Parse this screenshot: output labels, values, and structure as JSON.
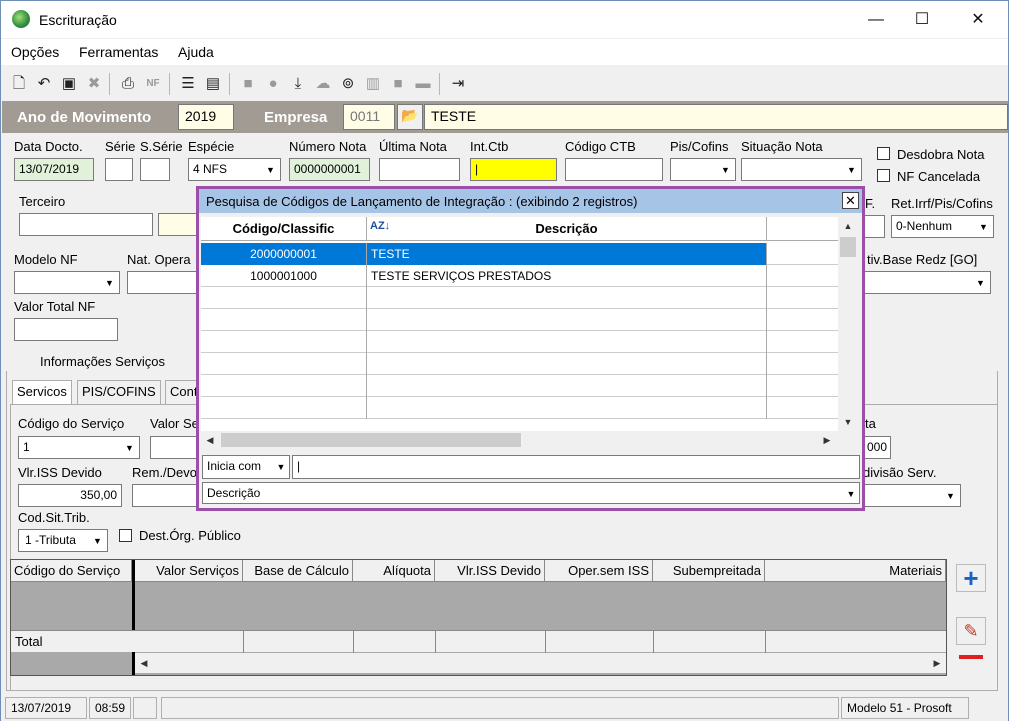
{
  "window": {
    "title": "Escrituração",
    "minimize": "—",
    "maximize": "☐",
    "close": "✕"
  },
  "menu": {
    "items": [
      "Opções",
      "Ferramentas",
      "Ajuda"
    ]
  },
  "toolbar": {
    "icons": [
      "new-icon",
      "undo-icon",
      "save-icon",
      "delete-icon",
      "preview-icon",
      "nfe-icon",
      "tree-icon",
      "calc-icon",
      "folder-icon",
      "apple-icon",
      "import-icon",
      "cloud-icon",
      "cib-icon",
      "barcode-icon",
      "gray-icon",
      "bar-icon",
      "exit-icon"
    ]
  },
  "header": {
    "ano_label": "Ano de Movimento",
    "ano_value": "2019",
    "empresa_label": "Empresa",
    "empresa_code": "0011",
    "empresa_name": "TESTE"
  },
  "form": {
    "data_docto_label": "Data Docto.",
    "data_docto": "13/07/2019",
    "serie_label": "Série",
    "sserie_label": "S.Série",
    "especie_label": "Espécie",
    "especie": "4 NFS",
    "numero_nota_label": "Número Nota",
    "numero_nota": "0000000001",
    "ultima_nota_label": "Última Nota",
    "int_ctb_label": "Int.Ctb",
    "codigo_ctb_label": "Código CTB",
    "pis_cofins_label": "Pis/Cofins",
    "situacao_nota_label": "Situação Nota",
    "desdobra_label": "Desdobra Nota",
    "nf_cancelada_label": "NF Cancelada",
    "terceiro_label": "Terceiro",
    "uf_label": "F.",
    "ret_irrf_label": "Ret.Irrf/Pis/Cofins",
    "ret_irrf_value": "0-Nenhum",
    "modelo_nf_label": "Modelo NF",
    "nat_opera_label": "Nat. Opera",
    "ativ_base_label": "tiv.Base Redz [GO]",
    "valor_total_label": "Valor Total NF",
    "info_servicos_label": "Informações Serviços"
  },
  "tabs": [
    "Servicos",
    "PIS/COFINS",
    "Cont"
  ],
  "servicos": {
    "codigo_servico_label": "Código do Serviço",
    "codigo_servico": "1",
    "valor_se_label": "Valor Se",
    "ta_label": "ta",
    "ta_value": "000",
    "vlr_iss_label": "Vlr.ISS Devido",
    "vlr_iss": "350,00",
    "rem_dev_label": "Rem./Devo",
    "divisao_label": "divisão Serv.",
    "cod_sit_trib_label": "Cod.Sit.Trib.",
    "cod_sit_trib": "1 -Tributa",
    "dest_orgao_label": "Dest.Órg. Público"
  },
  "grid": {
    "columns": [
      "Código do Serviço",
      "Valor Serviços",
      "Base de Cálculo",
      "Alíquota",
      "Vlr.ISS Devido",
      "Oper.sem ISS",
      "Subempreitada",
      "Materiais"
    ],
    "total_label": "Total"
  },
  "dialog": {
    "title": "Pesquisa de Códigos de Lançamento de Integração : (exibindo 2 registros)",
    "col1": "Código/Classific",
    "col2": "Descrição",
    "sort_icon": "AZ↓",
    "rows": [
      {
        "code": "2000000001",
        "desc": "TESTE"
      },
      {
        "code": "1000001000",
        "desc": "TESTE SERVIÇOS PRESTADOS"
      }
    ],
    "filter_mode": "Inicia com",
    "filter_value": "",
    "filter_field": "Descrição"
  },
  "status": {
    "date": "13/07/2019",
    "time": "08:59",
    "app": "Modelo 51 - Prosoft"
  },
  "colors": {
    "header_bg": "#a19b94",
    "dialog_border": "#9b4fa9",
    "dialog_title": "#a6c4e6",
    "selection": "#0078d7",
    "int_ctb_bg": "#ffff00",
    "data_docto_bg": "#e2f2da"
  }
}
